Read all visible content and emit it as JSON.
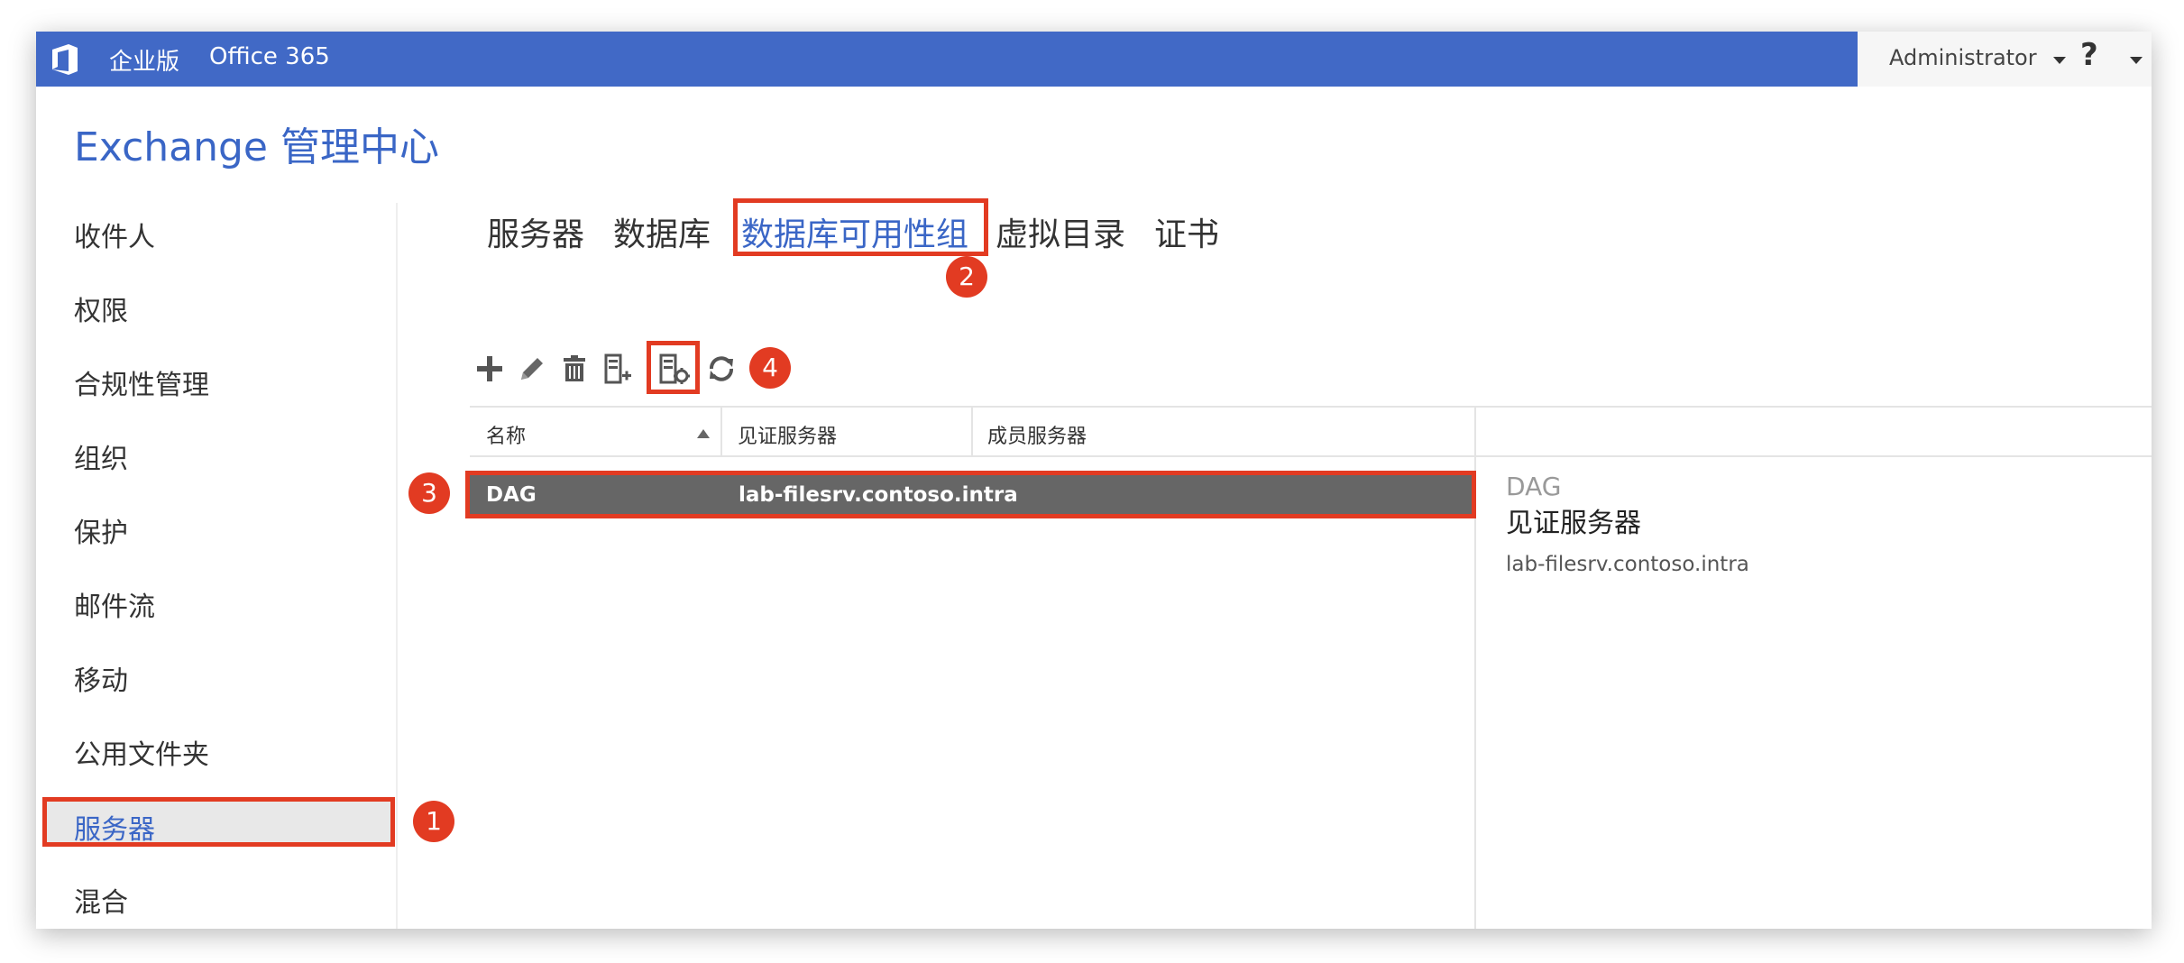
{
  "topbar": {
    "edition": "企业版",
    "product": "Office 365",
    "user": "Administrator",
    "help": "?"
  },
  "app_title": "Exchange 管理中心",
  "nav": {
    "items": [
      "收件人",
      "权限",
      "合规性管理",
      "组织",
      "保护",
      "邮件流",
      "移动",
      "公用文件夹",
      "服务器",
      "混合"
    ],
    "selected": "服务器"
  },
  "tabs": {
    "items": [
      "服务器",
      "数据库",
      "数据库可用性组",
      "虚拟目录",
      "证书"
    ],
    "active": "数据库可用性组"
  },
  "toolbar": {
    "icons": [
      "add-icon",
      "edit-icon",
      "delete-icon",
      "add-server-icon",
      "manage-membership-icon",
      "refresh-icon"
    ]
  },
  "table": {
    "columns": [
      "名称",
      "见证服务器",
      "成员服务器"
    ],
    "rows": [
      {
        "name": "DAG",
        "witness": "lab-filesrv.contoso.intra",
        "members": ""
      }
    ]
  },
  "details": {
    "name": "DAG",
    "label": "见证服务器",
    "value": "lab-filesrv.contoso.intra"
  },
  "annotations": {
    "step1": "1",
    "step2": "2",
    "step3": "3",
    "step4": "4",
    "color": "#e23b22"
  },
  "colors": {
    "topbar": "#4169c6",
    "accent": "#3a66c6",
    "selected_row": "#666666"
  }
}
